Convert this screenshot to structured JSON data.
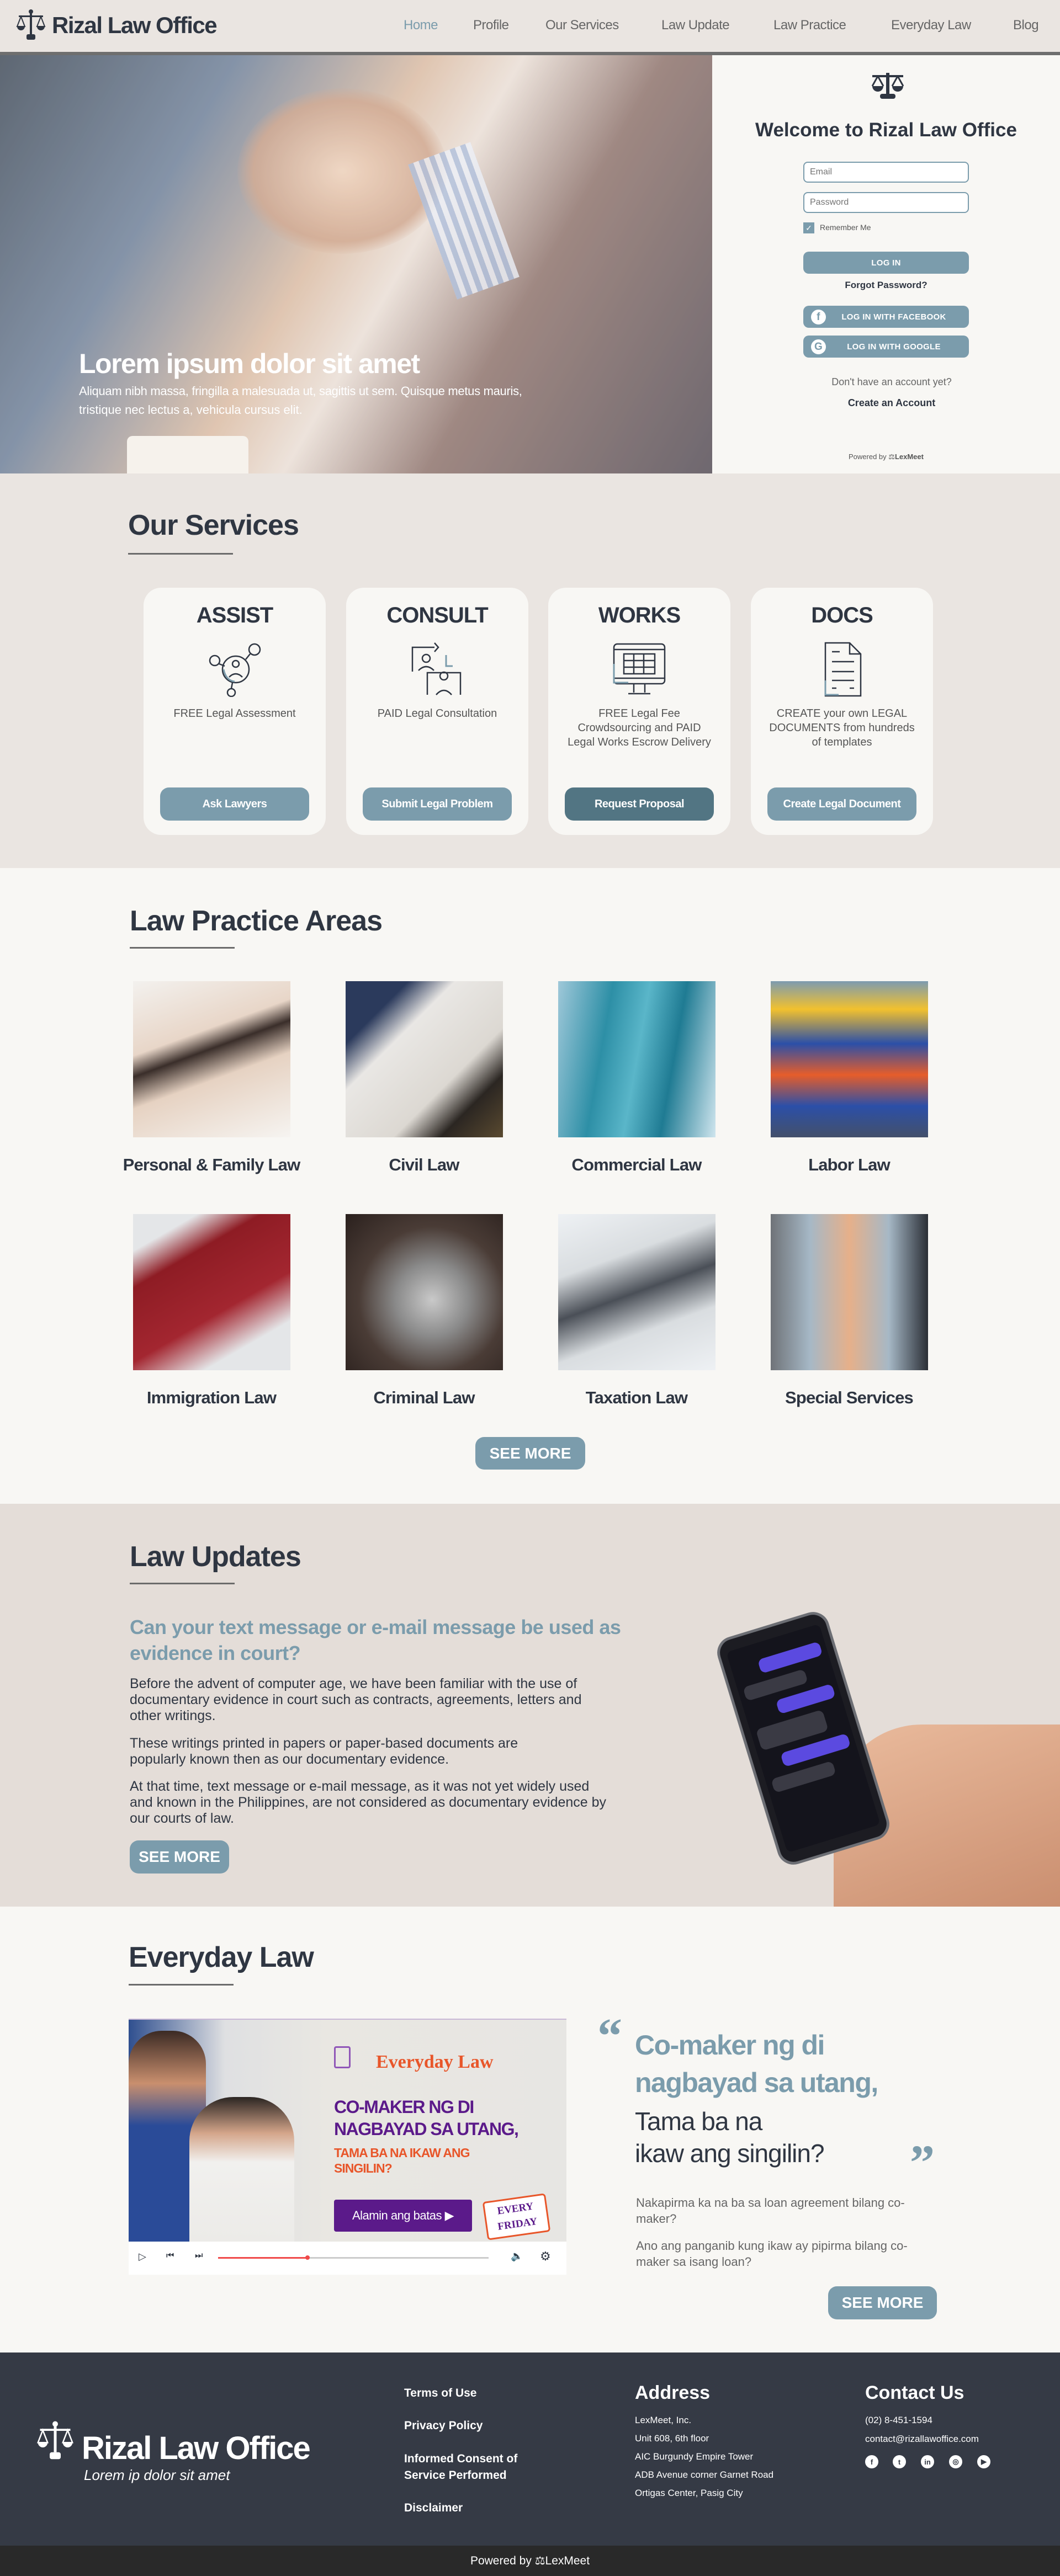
{
  "brand": {
    "name": "Rizal Law Office",
    "tagline": "Lorem ip dolor sit amet"
  },
  "nav": {
    "items": [
      "Home",
      "Profile",
      "Our Services",
      "Law Update",
      "Law Practice",
      "Everyday Law",
      "Blog"
    ],
    "active": "Home"
  },
  "hero": {
    "title": "Lorem ipsum dolor sit amet",
    "subtitle_line1": "Aliquam nibh massa, fringilla a malesuada ut, sagittis ut sem. Quisque metus mauris,",
    "subtitle_line2": "tristique nec lectus a, vehicula cursus elit."
  },
  "login": {
    "title": "Welcome to Rizal Law Office",
    "email_placeholder": "Email",
    "password_placeholder": "Password",
    "remember_label": "Remember Me",
    "remember_checked": true,
    "login_label": "LOG IN",
    "forgot_label": "Forgot Password?",
    "facebook_label": "LOG IN WITH FACEBOOK",
    "google_label": "LOG IN WITH GOOGLE",
    "no_account": "Don't have an account yet?",
    "create_label": "Create an Account",
    "powered_by": "Powered by",
    "powered_brand": "LexMeet"
  },
  "services": {
    "title": "Our Services",
    "cards": [
      {
        "title": "ASSIST",
        "desc": "FREE Legal Assessment",
        "button": "Ask Lawyers",
        "icon": "network-people-icon"
      },
      {
        "title": "CONSULT",
        "desc": "PAID Legal Consultation",
        "button": "Submit Legal Problem",
        "icon": "consultation-icon"
      },
      {
        "title": "WORKS",
        "desc": "FREE Legal Fee Crowdsourcing and PAID Legal Works Escrow Delivery",
        "button": "Request Proposal",
        "icon": "monitor-calendar-icon"
      },
      {
        "title": "DOCS",
        "desc": "CREATE your own LEGAL DOCUMENTS from hundreds of templates",
        "button": "Create Legal Document",
        "icon": "document-icon"
      }
    ]
  },
  "practice": {
    "title": "Law Practice Areas",
    "areas": [
      "Personal & Family Law",
      "Civil Law",
      "Commercial Law",
      "Labor Law",
      "Immigration Law",
      "Criminal Law",
      "Taxation Law",
      "Special Services"
    ],
    "see_more": "SEE MORE"
  },
  "updates": {
    "title": "Law Updates",
    "headline": "Can your text message or e-mail message be used as evidence in court?",
    "paragraphs": [
      "Before the advent of computer age, we have been familiar with the use of documentary evidence in court such as contracts, agreements, letters and other writings.",
      "These writings printed in papers or paper-based documents are popularly known then as our documentary evidence.",
      "At that time, text message or e-mail message, as it was not yet widely used and known in the Philippines, are not considered as documentary evidence by our courts of law."
    ],
    "see_more": "SEE MORE"
  },
  "everyday": {
    "title": "Everyday Law",
    "video": {
      "brand": "Everyday Law",
      "headline1": "CO-MAKER NG DI",
      "headline2": "NAGBAYAD SA UTANG,",
      "sub1": "TAMA BA NA IKAW ANG",
      "sub2": "SINGILIN?",
      "cta": "Alamin ang batas",
      "badge1": "EVERY",
      "badge2": "FRIDAY",
      "progress": 0.33
    },
    "quote_line1": "Co-maker ng di",
    "quote_line2": "nagbayad sa utang,",
    "quote_line3": "Tama ba na",
    "quote_line4": "ikaw ang singilin?",
    "paragraphs": [
      "Nakapirma ka na ba sa loan agreement bilang co-maker?",
      "Ano ang panganib kung ikaw ay pipirma bilang co-maker sa isang loan?"
    ],
    "see_more": "SEE MORE"
  },
  "footer": {
    "links": [
      "Terms of Use",
      "Privacy Policy",
      "Informed Consent of Service Performed",
      "Disclaimer"
    ],
    "address_title": "Address",
    "address_lines": [
      "LexMeet, Inc.",
      "Unit 608, 6th floor",
      "AIC Burgundy Empire Tower",
      "ADB Avenue corner Garnet Road",
      "Ortigas Center, Pasig City"
    ],
    "contact_title": "Contact Us",
    "phone": "(02) 8-451-1594",
    "email": "contact@rizallawoffice.com",
    "social": [
      "facebook-icon",
      "twitter-icon",
      "linkedin-icon",
      "instagram-icon",
      "youtube-icon"
    ],
    "powered_by": "Powered by",
    "powered_brand": "LexMeet"
  },
  "colors": {
    "accent": "#7b9cac",
    "dark": "#2f3642",
    "accent_dark": "#527583",
    "footer": "#353a45"
  }
}
